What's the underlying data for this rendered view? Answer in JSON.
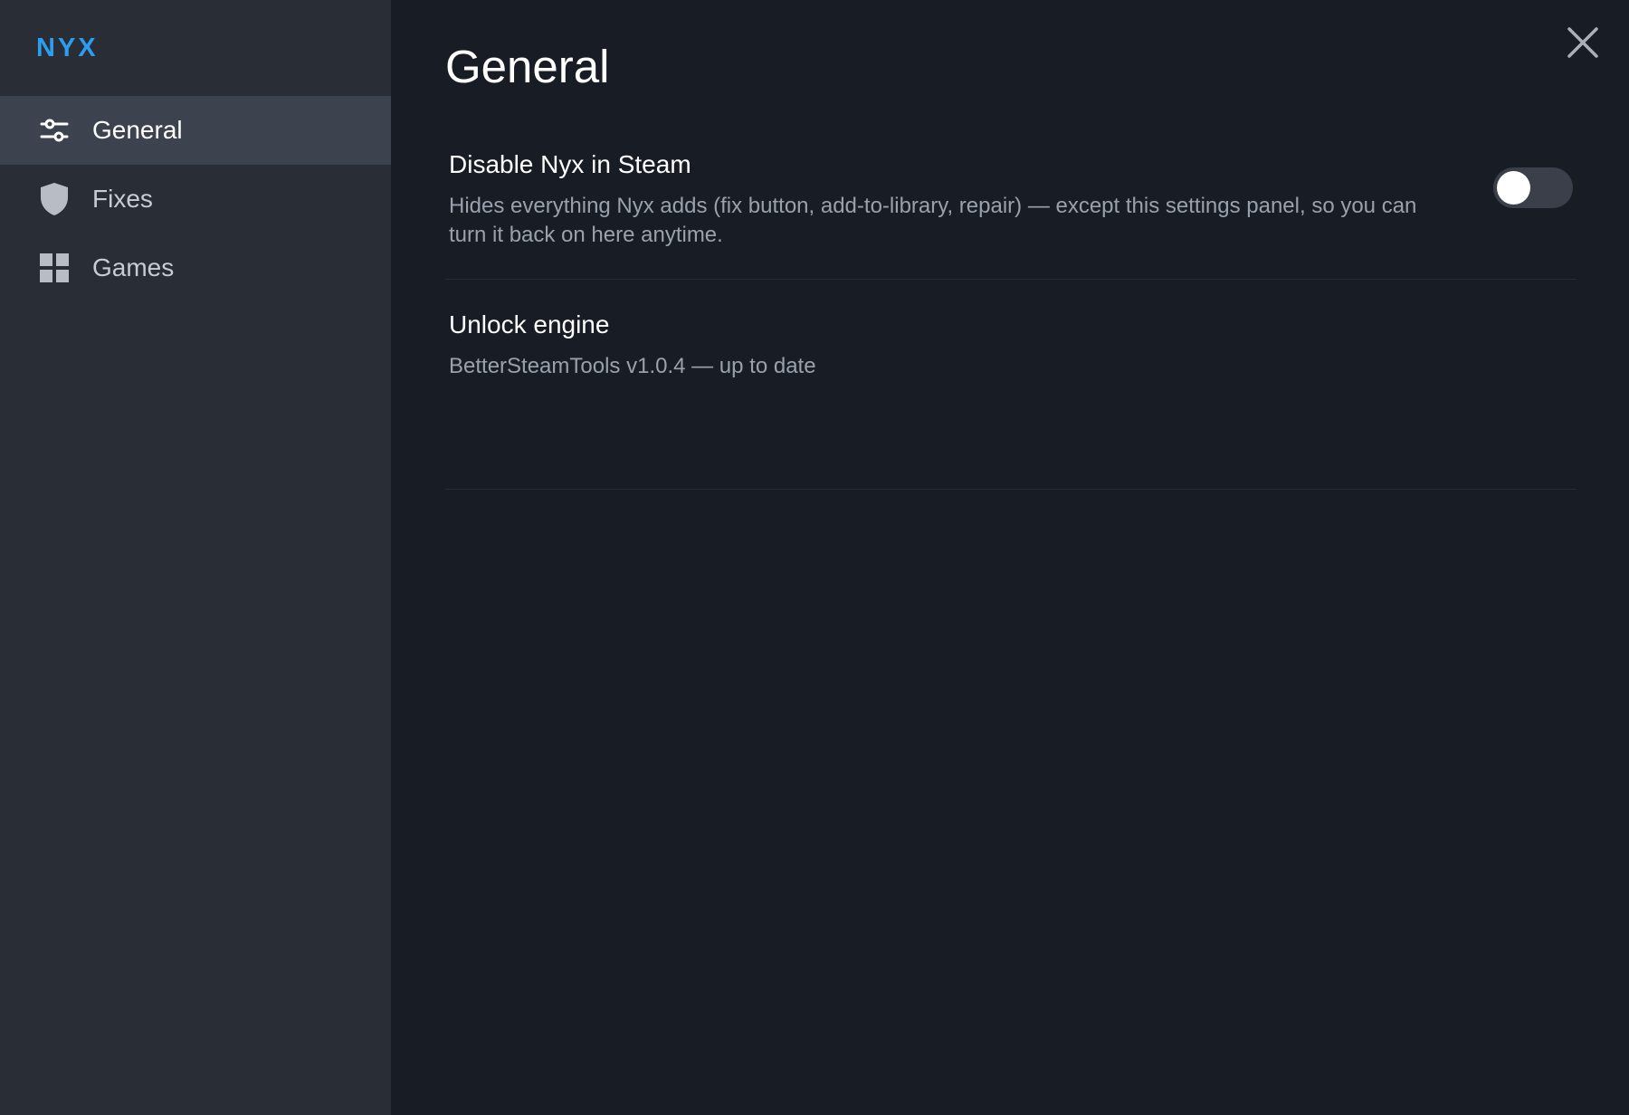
{
  "app": {
    "brand": "NYX"
  },
  "sidebar": {
    "items": [
      {
        "label": "General",
        "icon": "sliders-icon",
        "active": true
      },
      {
        "label": "Fixes",
        "icon": "shield-icon",
        "active": false
      },
      {
        "label": "Games",
        "icon": "grid-icon",
        "active": false
      }
    ]
  },
  "main": {
    "title": "General",
    "close_icon": "close-icon",
    "settings": [
      {
        "title": "Disable Nyx in Steam",
        "description": "Hides everything Nyx adds (fix button, add-to-library, repair) — except this settings panel, so you can turn it back on here anytime.",
        "toggle_on": false
      },
      {
        "title": "Unlock engine",
        "description": "BetterSteamTools v1.0.4 — up to date"
      }
    ]
  },
  "colors": {
    "accent": "#2d9df0",
    "sidebar_bg": "#292d36",
    "active_item_bg": "#3d434e",
    "main_bg": "#181d25",
    "toggle_off": "#3a3f49"
  }
}
